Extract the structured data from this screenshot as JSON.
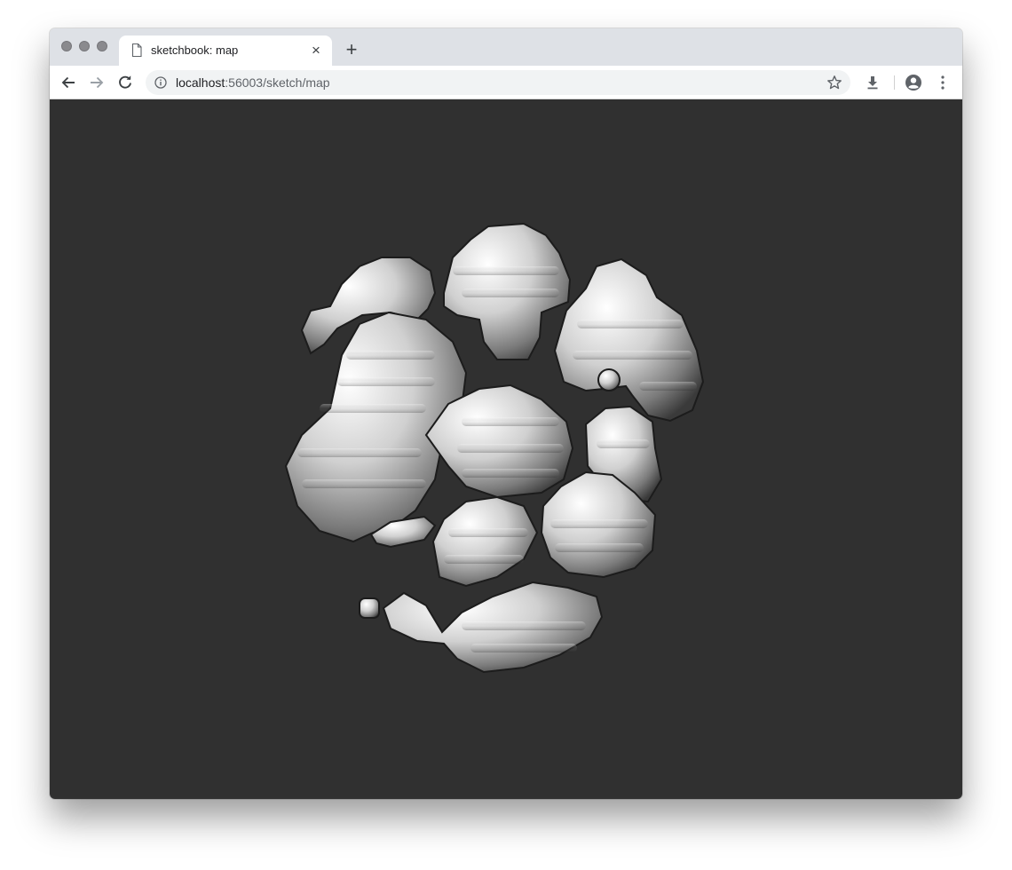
{
  "browser": {
    "tab": {
      "title": "sketchbook: map",
      "close_glyph": "×"
    },
    "new_tab_glyph": "+",
    "address": {
      "host": "localhost",
      "rest": ":56003/sketch/map"
    },
    "icons": {
      "page": "document-icon",
      "back": "arrow-left-icon",
      "forward": "arrow-right-icon",
      "reload": "reload-icon",
      "info": "info-icon",
      "bookmark": "star-icon",
      "download": "download-icon",
      "profile": "account-circle-icon",
      "menu": "more-vert-icon"
    }
  },
  "canvas": {
    "background": "#303030",
    "content": "3D voxel terrain render (white/grey blobs)"
  }
}
